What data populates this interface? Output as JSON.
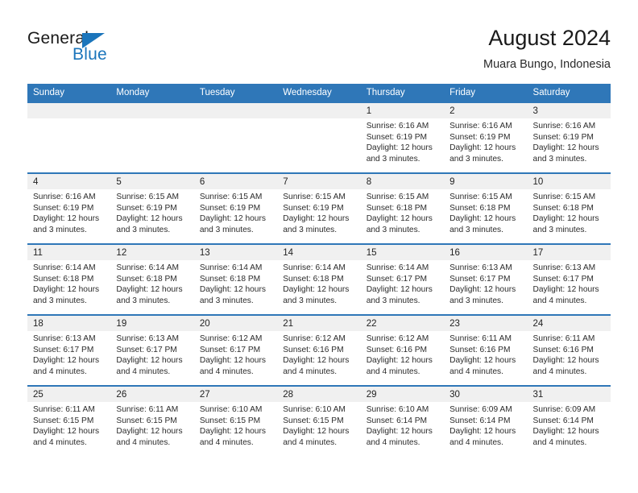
{
  "brand": {
    "name_part1": "General",
    "name_part2": "Blue",
    "triangle_icon": "triangle-icon",
    "color_primary": "#1b75bb",
    "color_text": "#1a1a1a"
  },
  "header": {
    "title": "August 2024",
    "subtitle": "Muara Bungo, Indonesia"
  },
  "calendar": {
    "header_bg": "#2f77b8",
    "day_band_bg": "#f0f0f0",
    "weekdays": [
      "Sunday",
      "Monday",
      "Tuesday",
      "Wednesday",
      "Thursday",
      "Friday",
      "Saturday"
    ],
    "weeks": [
      [
        {
          "day": "",
          "lines": []
        },
        {
          "day": "",
          "lines": []
        },
        {
          "day": "",
          "lines": []
        },
        {
          "day": "",
          "lines": []
        },
        {
          "day": "1",
          "lines": [
            "Sunrise: 6:16 AM",
            "Sunset: 6:19 PM",
            "Daylight: 12 hours",
            "and 3 minutes."
          ]
        },
        {
          "day": "2",
          "lines": [
            "Sunrise: 6:16 AM",
            "Sunset: 6:19 PM",
            "Daylight: 12 hours",
            "and 3 minutes."
          ]
        },
        {
          "day": "3",
          "lines": [
            "Sunrise: 6:16 AM",
            "Sunset: 6:19 PM",
            "Daylight: 12 hours",
            "and 3 minutes."
          ]
        }
      ],
      [
        {
          "day": "4",
          "lines": [
            "Sunrise: 6:16 AM",
            "Sunset: 6:19 PM",
            "Daylight: 12 hours",
            "and 3 minutes."
          ]
        },
        {
          "day": "5",
          "lines": [
            "Sunrise: 6:15 AM",
            "Sunset: 6:19 PM",
            "Daylight: 12 hours",
            "and 3 minutes."
          ]
        },
        {
          "day": "6",
          "lines": [
            "Sunrise: 6:15 AM",
            "Sunset: 6:19 PM",
            "Daylight: 12 hours",
            "and 3 minutes."
          ]
        },
        {
          "day": "7",
          "lines": [
            "Sunrise: 6:15 AM",
            "Sunset: 6:19 PM",
            "Daylight: 12 hours",
            "and 3 minutes."
          ]
        },
        {
          "day": "8",
          "lines": [
            "Sunrise: 6:15 AM",
            "Sunset: 6:18 PM",
            "Daylight: 12 hours",
            "and 3 minutes."
          ]
        },
        {
          "day": "9",
          "lines": [
            "Sunrise: 6:15 AM",
            "Sunset: 6:18 PM",
            "Daylight: 12 hours",
            "and 3 minutes."
          ]
        },
        {
          "day": "10",
          "lines": [
            "Sunrise: 6:15 AM",
            "Sunset: 6:18 PM",
            "Daylight: 12 hours",
            "and 3 minutes."
          ]
        }
      ],
      [
        {
          "day": "11",
          "lines": [
            "Sunrise: 6:14 AM",
            "Sunset: 6:18 PM",
            "Daylight: 12 hours",
            "and 3 minutes."
          ]
        },
        {
          "day": "12",
          "lines": [
            "Sunrise: 6:14 AM",
            "Sunset: 6:18 PM",
            "Daylight: 12 hours",
            "and 3 minutes."
          ]
        },
        {
          "day": "13",
          "lines": [
            "Sunrise: 6:14 AM",
            "Sunset: 6:18 PM",
            "Daylight: 12 hours",
            "and 3 minutes."
          ]
        },
        {
          "day": "14",
          "lines": [
            "Sunrise: 6:14 AM",
            "Sunset: 6:18 PM",
            "Daylight: 12 hours",
            "and 3 minutes."
          ]
        },
        {
          "day": "15",
          "lines": [
            "Sunrise: 6:14 AM",
            "Sunset: 6:17 PM",
            "Daylight: 12 hours",
            "and 3 minutes."
          ]
        },
        {
          "day": "16",
          "lines": [
            "Sunrise: 6:13 AM",
            "Sunset: 6:17 PM",
            "Daylight: 12 hours",
            "and 3 minutes."
          ]
        },
        {
          "day": "17",
          "lines": [
            "Sunrise: 6:13 AM",
            "Sunset: 6:17 PM",
            "Daylight: 12 hours",
            "and 4 minutes."
          ]
        }
      ],
      [
        {
          "day": "18",
          "lines": [
            "Sunrise: 6:13 AM",
            "Sunset: 6:17 PM",
            "Daylight: 12 hours",
            "and 4 minutes."
          ]
        },
        {
          "day": "19",
          "lines": [
            "Sunrise: 6:13 AM",
            "Sunset: 6:17 PM",
            "Daylight: 12 hours",
            "and 4 minutes."
          ]
        },
        {
          "day": "20",
          "lines": [
            "Sunrise: 6:12 AM",
            "Sunset: 6:17 PM",
            "Daylight: 12 hours",
            "and 4 minutes."
          ]
        },
        {
          "day": "21",
          "lines": [
            "Sunrise: 6:12 AM",
            "Sunset: 6:16 PM",
            "Daylight: 12 hours",
            "and 4 minutes."
          ]
        },
        {
          "day": "22",
          "lines": [
            "Sunrise: 6:12 AM",
            "Sunset: 6:16 PM",
            "Daylight: 12 hours",
            "and 4 minutes."
          ]
        },
        {
          "day": "23",
          "lines": [
            "Sunrise: 6:11 AM",
            "Sunset: 6:16 PM",
            "Daylight: 12 hours",
            "and 4 minutes."
          ]
        },
        {
          "day": "24",
          "lines": [
            "Sunrise: 6:11 AM",
            "Sunset: 6:16 PM",
            "Daylight: 12 hours",
            "and 4 minutes."
          ]
        }
      ],
      [
        {
          "day": "25",
          "lines": [
            "Sunrise: 6:11 AM",
            "Sunset: 6:15 PM",
            "Daylight: 12 hours",
            "and 4 minutes."
          ]
        },
        {
          "day": "26",
          "lines": [
            "Sunrise: 6:11 AM",
            "Sunset: 6:15 PM",
            "Daylight: 12 hours",
            "and 4 minutes."
          ]
        },
        {
          "day": "27",
          "lines": [
            "Sunrise: 6:10 AM",
            "Sunset: 6:15 PM",
            "Daylight: 12 hours",
            "and 4 minutes."
          ]
        },
        {
          "day": "28",
          "lines": [
            "Sunrise: 6:10 AM",
            "Sunset: 6:15 PM",
            "Daylight: 12 hours",
            "and 4 minutes."
          ]
        },
        {
          "day": "29",
          "lines": [
            "Sunrise: 6:10 AM",
            "Sunset: 6:14 PM",
            "Daylight: 12 hours",
            "and 4 minutes."
          ]
        },
        {
          "day": "30",
          "lines": [
            "Sunrise: 6:09 AM",
            "Sunset: 6:14 PM",
            "Daylight: 12 hours",
            "and 4 minutes."
          ]
        },
        {
          "day": "31",
          "lines": [
            "Sunrise: 6:09 AM",
            "Sunset: 6:14 PM",
            "Daylight: 12 hours",
            "and 4 minutes."
          ]
        }
      ]
    ]
  }
}
